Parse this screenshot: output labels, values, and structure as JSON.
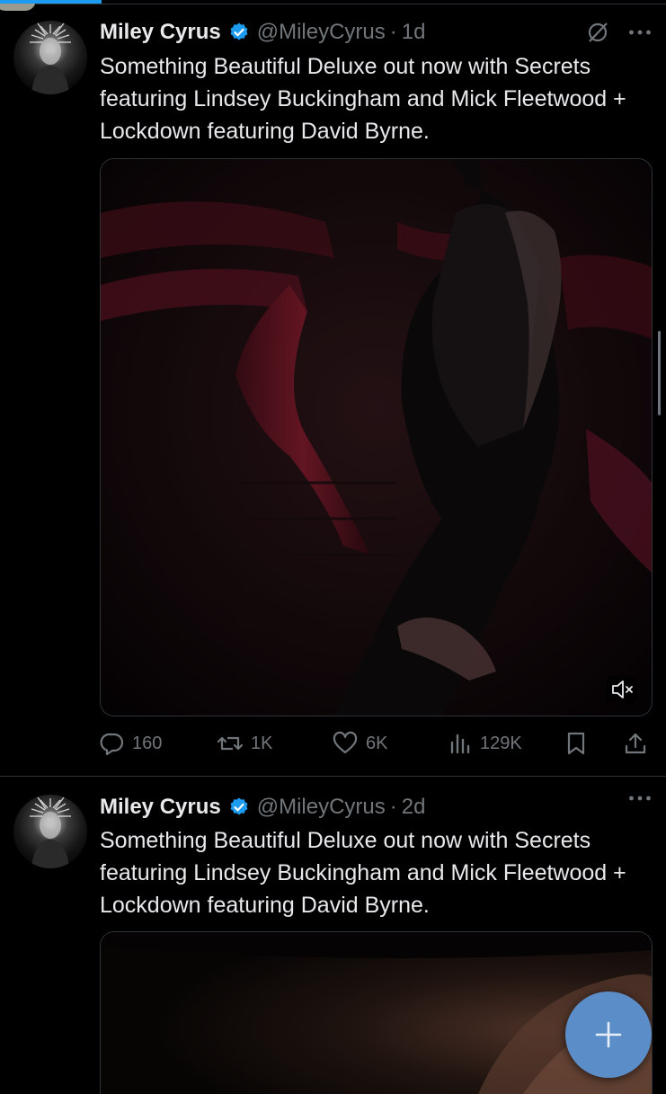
{
  "tweets": [
    {
      "author_name": "Miley Cyrus",
      "handle": "@MileyCyrus",
      "separator": "·",
      "time": "1d",
      "text": "Something Beautiful Deluxe out now with Secrets featuring Lindsey Buckingham and Mick Fleetwood + Lockdown featuring David Byrne.",
      "media": "video",
      "counts": {
        "replies": "160",
        "reposts": "1K",
        "likes": "6K",
        "views": "129K"
      }
    },
    {
      "author_name": "Miley Cyrus",
      "handle": "@MileyCyrus",
      "separator": "·",
      "time": "2d",
      "text": "Something Beautiful Deluxe out now with Secrets featuring Lindsey Buckingham and Mick Fleetwood + Lockdown featuring David Byrne.",
      "media": "image"
    }
  ],
  "icons": {
    "verified": "verified-badge-icon",
    "grok": "grok-icon",
    "more": "more-icon",
    "mute": "mute-icon",
    "reply": "reply-icon",
    "repost": "repost-icon",
    "like": "like-icon",
    "views": "views-icon",
    "bookmark": "bookmark-icon",
    "share": "share-icon",
    "compose": "plus-icon"
  },
  "colors": {
    "background": "#000000",
    "text": "#e7e9ea",
    "muted": "#71767b",
    "accent": "#1d9bf0",
    "fab": "#5b8ec9"
  }
}
